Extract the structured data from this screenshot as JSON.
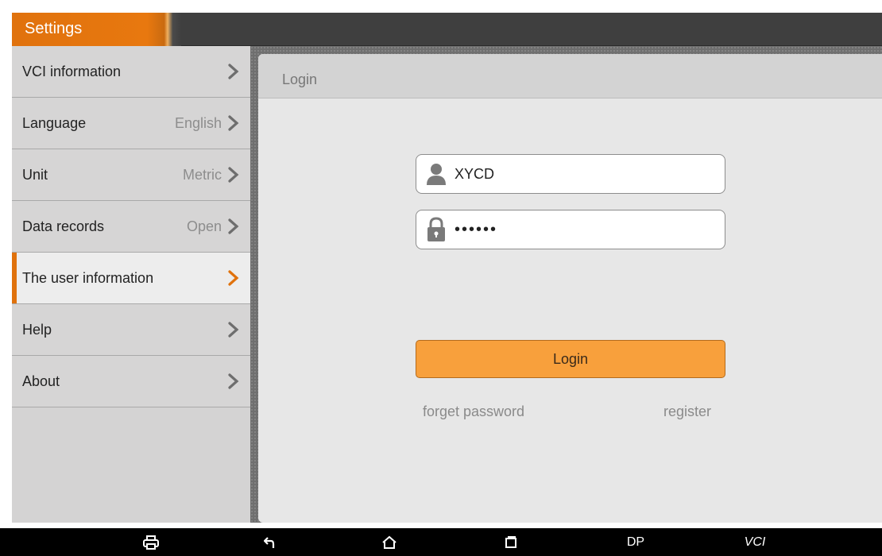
{
  "header": {
    "title": "Settings"
  },
  "sidebar": {
    "items": [
      {
        "label": "VCI information",
        "value": ""
      },
      {
        "label": "Language",
        "value": "English"
      },
      {
        "label": "Unit",
        "value": "Metric"
      },
      {
        "label": "Data records",
        "value": "Open"
      },
      {
        "label": "The user information",
        "value": ""
      },
      {
        "label": "Help",
        "value": ""
      },
      {
        "label": "About",
        "value": ""
      }
    ],
    "active_index": 4
  },
  "panel": {
    "title": "Login",
    "username_value": "XYCD",
    "password_value": "••••••",
    "login_label": "Login",
    "forget_password_label": "forget password",
    "register_label": "register"
  },
  "navbar": {
    "items": [
      "print-icon",
      "back-icon",
      "home-icon",
      "recents-icon",
      "DP",
      "VCI"
    ],
    "dp_label": "DP",
    "vci_label": "VCI"
  },
  "colors": {
    "accent": "#e0720d",
    "login_button": "#f8a03c",
    "sidebar_bg": "#d6d5d5",
    "panel_bg": "#e7e7e7",
    "topbar_bg": "#3f3f3f"
  }
}
